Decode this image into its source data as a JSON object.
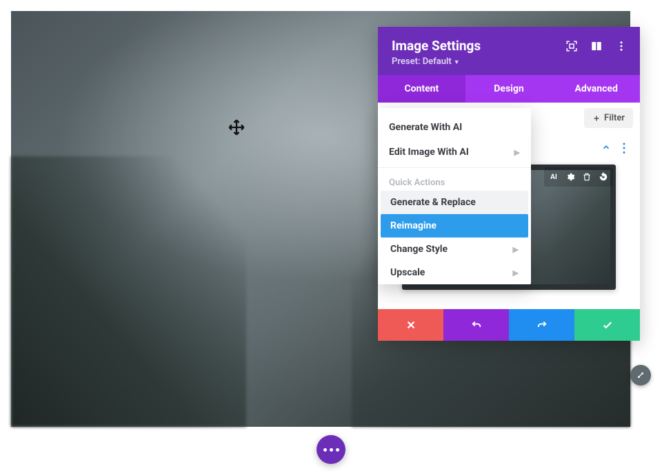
{
  "panel": {
    "title": "Image Settings",
    "preset_label": "Preset: Default",
    "tabs": {
      "content": "Content",
      "design": "Design",
      "advanced": "Advanced"
    },
    "filter_label": "Filter"
  },
  "dropdown": {
    "generate_with_ai": "Generate With AI",
    "edit_image_with_ai": "Edit Image With AI",
    "quick_actions_heading": "Quick Actions",
    "quick_actions": {
      "generate_replace": "Generate & Replace",
      "reimagine": "Reimagine",
      "change_style": "Change Style",
      "upscale": "Upscale"
    }
  },
  "icons": {
    "expand": "expand",
    "columns": "columns",
    "more": "more",
    "ai": "AI",
    "gear": "gear",
    "trash": "trash",
    "reset": "reset"
  }
}
